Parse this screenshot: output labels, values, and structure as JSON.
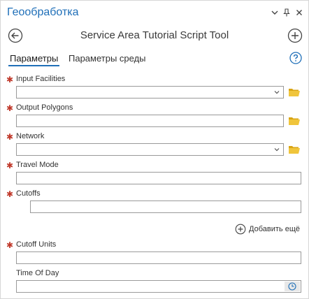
{
  "window": {
    "title": "Геообработка",
    "dropdown_glyph": "⌄",
    "pin_glyph": "↕",
    "close_glyph": "✕"
  },
  "tool": {
    "title": "Service Area Tutorial Script Tool",
    "back_icon": "back-arrow-icon",
    "add_icon": "plus-circle-icon"
  },
  "tabs": [
    {
      "label": "Параметры",
      "active": true
    },
    {
      "label": "Параметры среды",
      "active": false
    }
  ],
  "help_icon": "help-icon",
  "params": [
    {
      "label": "Input Facilities",
      "required": true,
      "type": "dropdown-folder"
    },
    {
      "label": "Output Polygons",
      "required": true,
      "type": "text-folder"
    },
    {
      "label": "Network",
      "required": true,
      "type": "dropdown-folder"
    },
    {
      "label": "Travel Mode",
      "required": true,
      "type": "text"
    },
    {
      "label": "Cutoffs",
      "required": true,
      "type": "list"
    },
    {
      "label": "Cutoff Units",
      "required": true,
      "type": "text"
    },
    {
      "label": "Time Of Day",
      "required": false,
      "type": "datetime"
    }
  ],
  "add_more_label": "Добавить ещё",
  "required_marker": "✱",
  "colors": {
    "accent": "#1f6fb8",
    "required": "#c0392b",
    "folder": "#e8b923"
  }
}
